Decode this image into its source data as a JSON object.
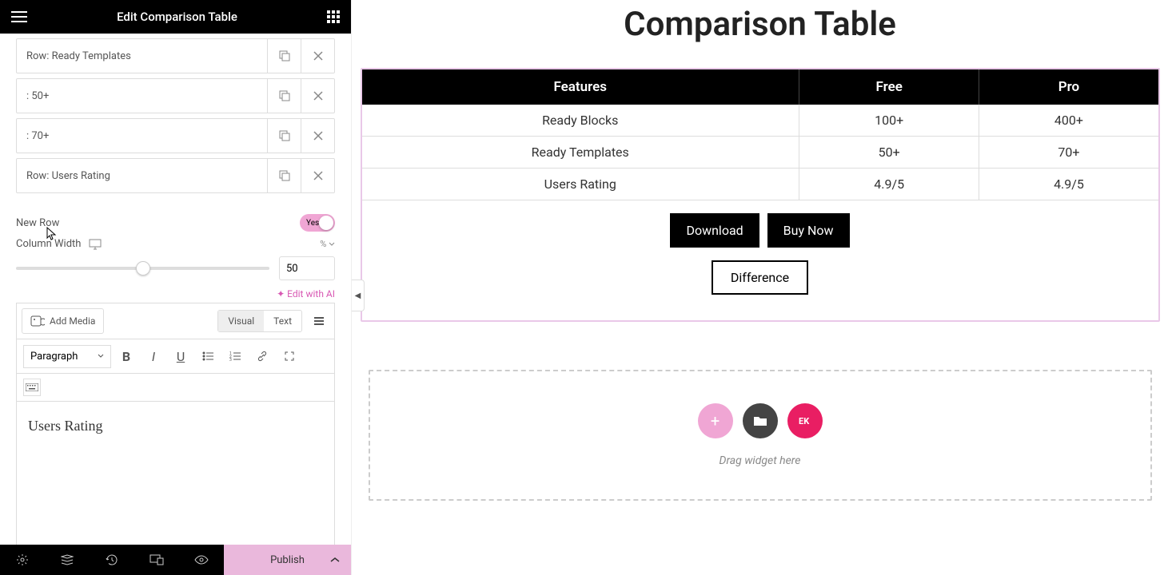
{
  "panel": {
    "title": "Edit Comparison Table",
    "rows": [
      {
        "label": "Row: Ready Templates"
      },
      {
        "label": ": 50+"
      },
      {
        "label": ": 70+"
      },
      {
        "label": "Row: Users Rating"
      }
    ],
    "new_row": {
      "label": "New Row",
      "value": "Yes"
    },
    "column_width": {
      "label": "Column Width",
      "unit": "%",
      "value": "50",
      "percent": 50
    },
    "edit_ai": "Edit with AI",
    "add_media": "Add Media",
    "tabs": {
      "visual": "Visual",
      "text": "Text"
    },
    "format": "Paragraph",
    "content": "Users Rating",
    "publish": "Publish"
  },
  "preview": {
    "title": "Comparison Table",
    "table": {
      "headers": [
        "Features",
        "Free",
        "Pro"
      ],
      "rows": [
        {
          "feature": "Ready Blocks",
          "free": "100+",
          "pro": "400+"
        },
        {
          "feature": "Ready Templates",
          "free": "50+",
          "pro": "70+"
        },
        {
          "feature": "Users Rating",
          "free": "4.9/5",
          "pro": "4.9/5"
        }
      ]
    },
    "buttons": {
      "download": "Download",
      "buy": "Buy Now",
      "diff": "Difference"
    },
    "dropzone": "Drag widget here"
  }
}
